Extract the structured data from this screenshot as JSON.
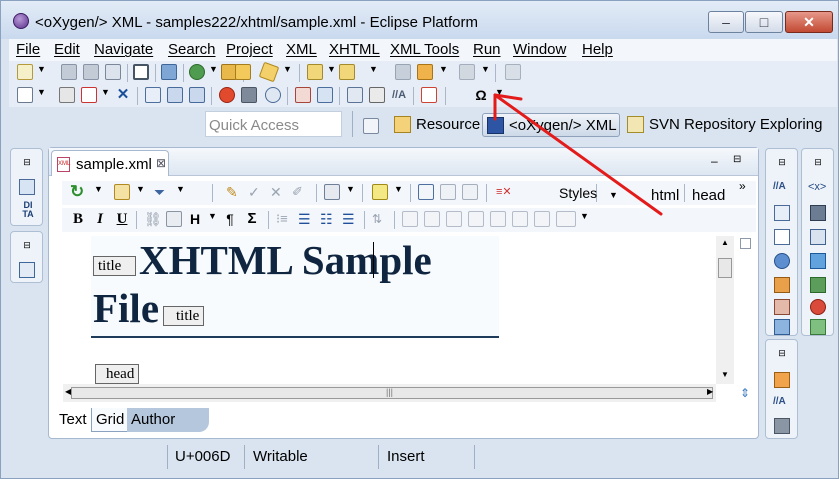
{
  "window": {
    "title": "<oXygen/> XML - samples222/xhtml/sample.xml - Eclipse Platform",
    "minimize_symbol": "–",
    "maximize_symbol": "□",
    "close_symbol": "✕"
  },
  "menu": {
    "items": [
      "File",
      "Edit",
      "Navigate",
      "Search",
      "Project",
      "XML",
      "XHTML",
      "XML Tools",
      "Run",
      "Window",
      "Help"
    ]
  },
  "perspectives": {
    "quick_access_placeholder": "Quick Access",
    "items": [
      {
        "label": "Resource",
        "icon": "resource-perspective-icon"
      },
      {
        "label": "<oXygen/> XML",
        "icon": "oxygen-perspective-icon"
      },
      {
        "label": "SVN Repository Exploring",
        "icon": "svn-perspective-icon"
      }
    ]
  },
  "toolbar": {
    "special_char_symbol": "Ω"
  },
  "editor": {
    "tab_label": "sample.xml",
    "tab_close": "⊠",
    "styles_label": "Styles",
    "breadcrumb": [
      "html",
      "head"
    ],
    "overflow_symbol": "»",
    "document": {
      "title_line1": "XHTML Sample",
      "title_line2": "File",
      "start_tag": "title",
      "end_tag": "title",
      "head_tag": "head"
    },
    "mode_tabs": [
      "Text",
      "Grid",
      "Author"
    ],
    "selected_mode": "Grid"
  },
  "status": {
    "char_code": "U+006D",
    "writable": "Writable",
    "insert_mode": "Insert"
  },
  "colors": {
    "annotation_arrow": "#e31b1b",
    "title_text": "#0f2540",
    "chrome_bg": "#dae4f0"
  }
}
